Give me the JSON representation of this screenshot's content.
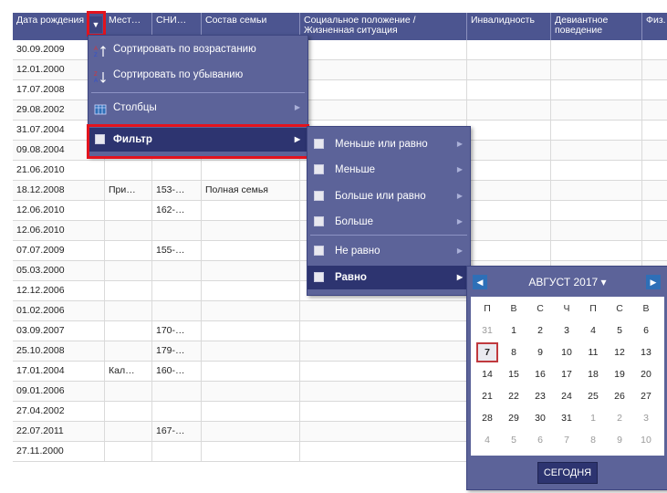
{
  "table": {
    "headers": [
      {
        "label": "Дата рождения"
      },
      {
        "label": "Мест…"
      },
      {
        "label": "СНИ…"
      },
      {
        "label": "Состав семьи"
      },
      {
        "label": "Социальное положение / Жизненная ситуация"
      },
      {
        "label": "Инвалидность"
      },
      {
        "label": "Девиантное поведение"
      },
      {
        "label": "Физ. груп"
      }
    ],
    "rows": [
      [
        "30.09.2009",
        "",
        "",
        "",
        "",
        "",
        "",
        ""
      ],
      [
        "12.01.2000",
        "",
        "",
        "",
        "",
        "",
        "",
        ""
      ],
      [
        "17.07.2008",
        "",
        "",
        "",
        "",
        "",
        "",
        ""
      ],
      [
        "29.08.2002",
        "",
        "",
        "",
        "",
        "",
        "",
        ""
      ],
      [
        "31.07.2004",
        "",
        "",
        "",
        "",
        "",
        "",
        ""
      ],
      [
        "09.08.2004",
        "",
        "",
        "",
        "",
        "",
        "",
        ""
      ],
      [
        "21.06.2010",
        "",
        "",
        "",
        "",
        "",
        "",
        ""
      ],
      [
        "18.12.2008",
        "При…",
        "153-…",
        "Полная семья",
        "",
        "",
        "",
        ""
      ],
      [
        "12.06.2010",
        "",
        "162-…",
        "",
        "",
        "",
        "",
        ""
      ],
      [
        "12.06.2010",
        "",
        "",
        "",
        "",
        "",
        "",
        ""
      ],
      [
        "07.07.2009",
        "",
        "155-…",
        "",
        "",
        "",
        "",
        ""
      ],
      [
        "05.03.2000",
        "",
        "",
        "",
        "",
        "",
        "",
        ""
      ],
      [
        "12.12.2006",
        "",
        "",
        "",
        "",
        "",
        "",
        ""
      ],
      [
        "01.02.2006",
        "",
        "",
        "",
        "",
        "",
        "",
        ""
      ],
      [
        "03.09.2007",
        "",
        "170-…",
        "",
        "",
        "",
        "",
        ""
      ],
      [
        "25.10.2008",
        "",
        "179-…",
        "",
        "",
        "",
        "",
        ""
      ],
      [
        "17.01.2004",
        "Кал…",
        "160-…",
        "",
        "",
        "",
        "",
        ""
      ],
      [
        "09.01.2006",
        "",
        "",
        "",
        "",
        "",
        "",
        ""
      ],
      [
        "27.04.2002",
        "",
        "",
        "",
        "",
        "",
        "",
        ""
      ],
      [
        "22.07.2011",
        "",
        "167-…",
        "",
        "",
        "",
        "",
        ""
      ],
      [
        "27.11.2000",
        "",
        "",
        "",
        "",
        "",
        "",
        ""
      ]
    ]
  },
  "column_menu": {
    "sort_asc": "Сортировать по возрастанию",
    "sort_desc": "Сортировать по убыванию",
    "columns": "Столбцы",
    "filter": "Фильтр"
  },
  "filter_menu": {
    "items": [
      "Меньше или равно",
      "Меньше",
      "Больше или равно",
      "Больше",
      "Не равно",
      "Равно"
    ]
  },
  "calendar": {
    "title": "АВГУСТ 2017",
    "caret": "▾",
    "weekdays": [
      "П",
      "В",
      "С",
      "Ч",
      "П",
      "С",
      "В"
    ],
    "weeks": [
      [
        "31",
        "1",
        "2",
        "3",
        "4",
        "5",
        "6"
      ],
      [
        "7",
        "8",
        "9",
        "10",
        "11",
        "12",
        "13"
      ],
      [
        "14",
        "15",
        "16",
        "17",
        "18",
        "19",
        "20"
      ],
      [
        "21",
        "22",
        "23",
        "24",
        "25",
        "26",
        "27"
      ],
      [
        "28",
        "29",
        "30",
        "31",
        "1",
        "2",
        "3"
      ],
      [
        "4",
        "5",
        "6",
        "7",
        "8",
        "9",
        "10"
      ]
    ],
    "today_button": "СЕГОДНЯ"
  },
  "colors": {
    "header_bg": "#4c5590",
    "menu_bg": "#5c6399",
    "menu_selected": "#2d3470",
    "highlight": "#e3131e"
  }
}
